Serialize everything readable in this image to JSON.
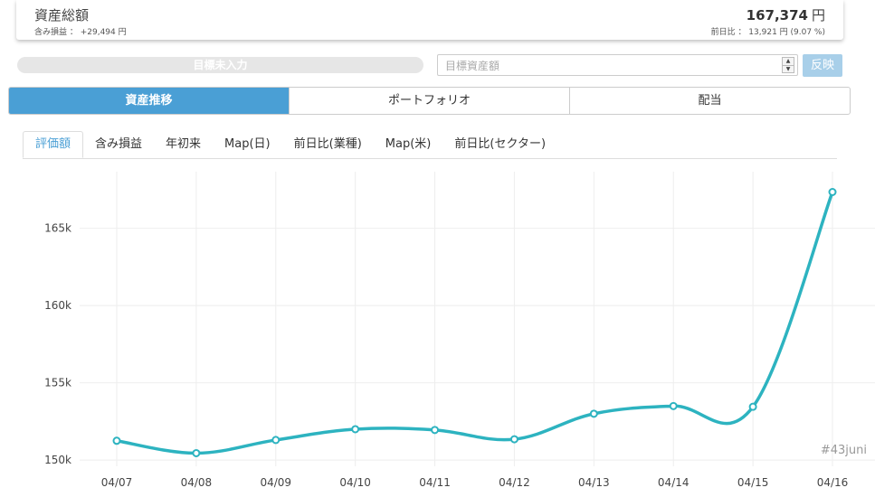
{
  "summary": {
    "title": "資産総額",
    "unrealized_label": "含み損益 ： +29,494 円",
    "total_value": "167,374",
    "total_unit": "円",
    "change_label": "前日比 ： 13,921 円 (9.07 %)"
  },
  "goal": {
    "bar_text": "目標未入力",
    "input_placeholder": "目標資産額",
    "reflect_label": "反映",
    "progress_percent": 0
  },
  "main_tabs": [
    {
      "label": "資産推移",
      "active": true
    },
    {
      "label": "ポートフォリオ",
      "active": false
    },
    {
      "label": "配当",
      "active": false
    }
  ],
  "sub_tabs": [
    {
      "label": "評価額",
      "active": true
    },
    {
      "label": "含み損益",
      "active": false
    },
    {
      "label": "年初来",
      "active": false
    },
    {
      "label": "Map(日)",
      "active": false
    },
    {
      "label": "前日比(業種)",
      "active": false
    },
    {
      "label": "Map(米)",
      "active": false
    },
    {
      "label": "前日比(セクター)",
      "active": false
    }
  ],
  "chart_data": {
    "type": "line",
    "title": "",
    "xlabel": "",
    "ylabel": "",
    "x": [
      "04/07",
      "04/08",
      "04/09",
      "04/10",
      "04/11",
      "04/12",
      "04/13",
      "04/14",
      "04/15",
      "04/16"
    ],
    "values": [
      151250,
      150450,
      151300,
      152000,
      151950,
      151350,
      153000,
      153500,
      153450,
      167350
    ],
    "y_ticks": [
      "150k",
      "155k",
      "160k",
      "165k"
    ],
    "y_tick_values": [
      150000,
      155000,
      160000,
      165000
    ],
    "ylim": [
      149600,
      168900
    ],
    "line_color": "#2db3c0",
    "grid": true
  },
  "watermark": "#43juni",
  "icons": {
    "spin_up": "▲",
    "spin_down": "▼"
  }
}
